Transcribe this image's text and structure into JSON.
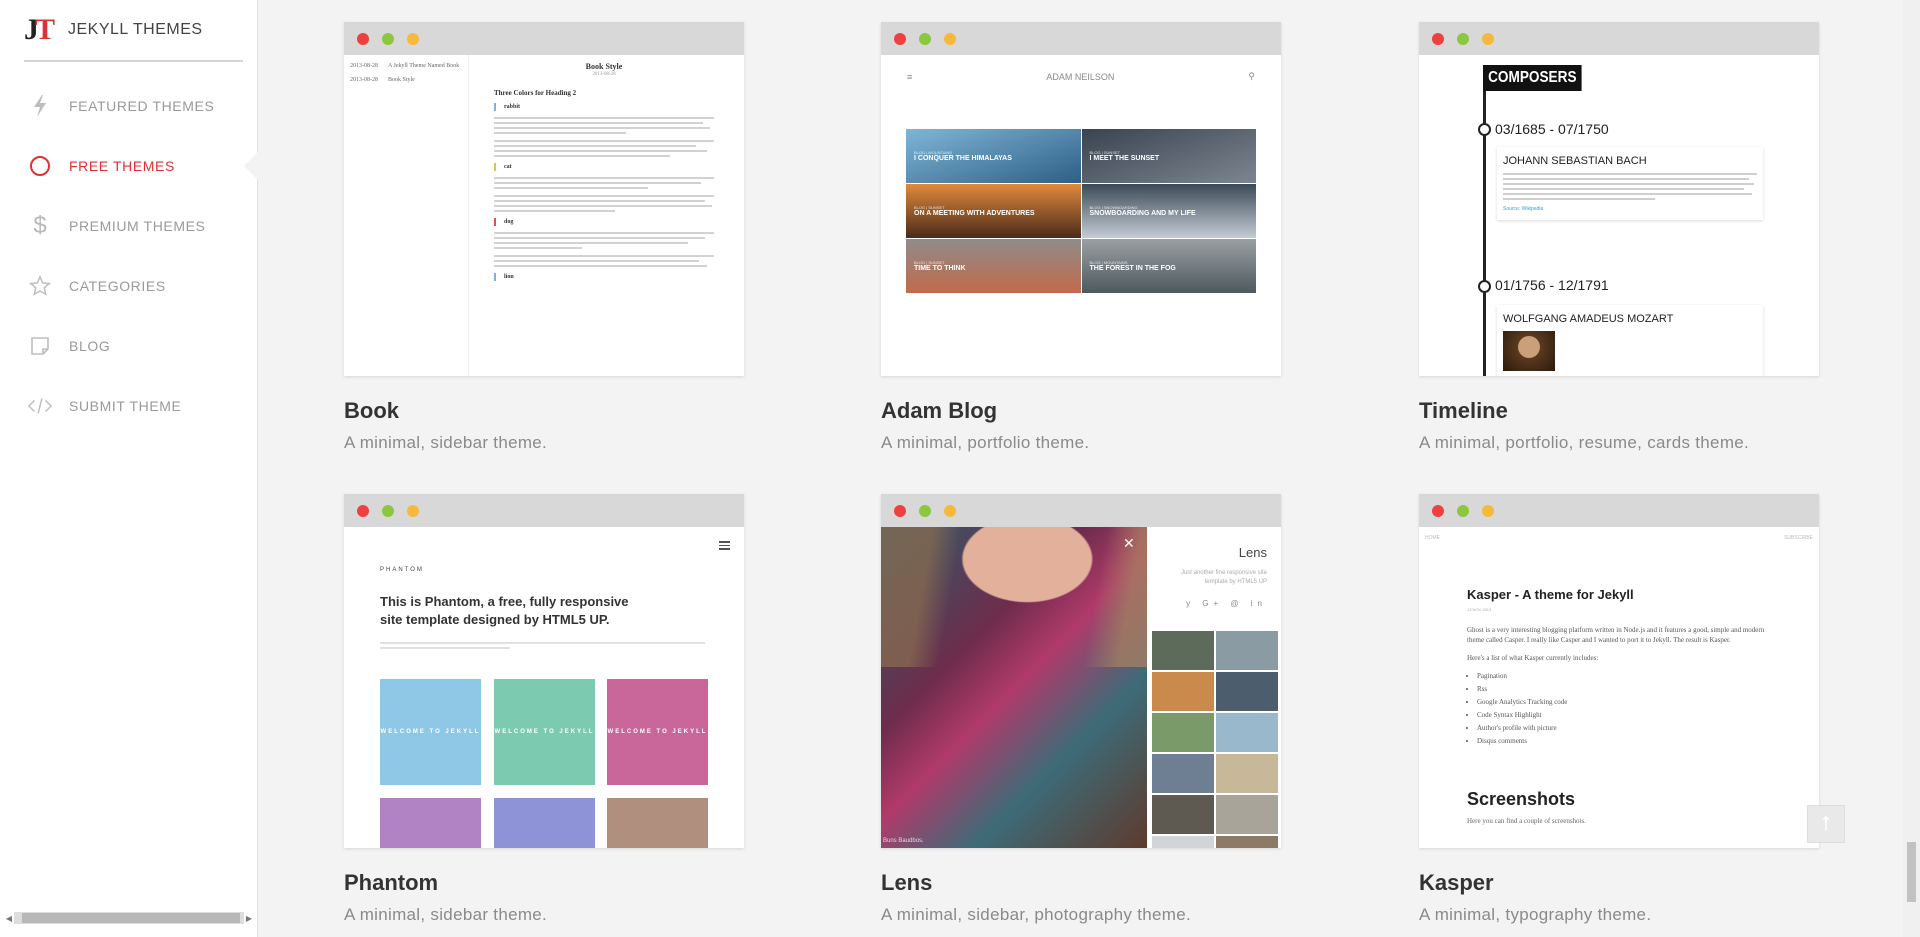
{
  "brand": {
    "name": "JEKYLL THEMES",
    "logo_text": "JT"
  },
  "nav": [
    {
      "label": "FEATURED THEMES",
      "icon": "bolt-icon"
    },
    {
      "label": "FREE THEMES",
      "icon": "circle-icon",
      "active": true
    },
    {
      "label": "PREMIUM THEMES",
      "icon": "dollar-icon"
    },
    {
      "label": "CATEGORIES",
      "icon": "star-icon"
    },
    {
      "label": "BLOG",
      "icon": "note-icon"
    },
    {
      "label": "SUBMIT THEME",
      "icon": "code-icon"
    }
  ],
  "themes": [
    {
      "name": "Book",
      "desc": "A minimal, sidebar theme."
    },
    {
      "name": "Adam Blog",
      "desc": "A minimal, portfolio theme."
    },
    {
      "name": "Timeline",
      "desc": "A minimal, portfolio, resume, cards theme."
    },
    {
      "name": "Phantom",
      "desc": "A minimal, sidebar theme."
    },
    {
      "name": "Lens",
      "desc": "A minimal, sidebar, photography theme."
    },
    {
      "name": "Kasper",
      "desc": "A minimal, typography theme."
    }
  ],
  "previews": {
    "book": {
      "side": [
        [
          "2013-08-28",
          "A Jekyll Theme Named Book"
        ],
        [
          "2013-08-28",
          "Book Style"
        ]
      ],
      "title": "Book Style",
      "date": "2013-08-28",
      "heading": "Three Colors for Heading 2",
      "tags": [
        "rabbit",
        "cat",
        "dog",
        "lion"
      ]
    },
    "adam": {
      "header": "ADAM NEILSON",
      "tiles": [
        {
          "cat": "BLOG | MOUNTAINS",
          "title": "I CONQUER THE HIMALAYAS"
        },
        {
          "cat": "BLOG | SUNSET",
          "title": "I MEET THE SUNSET"
        },
        {
          "cat": "BLOG | SUNSET",
          "title": "ON A MEETING WITH ADVENTURES"
        },
        {
          "cat": "BLOG | SNOWBOARDING",
          "title": "SNOWBOARDING AND MY LIFE"
        },
        {
          "cat": "BLOG | SUNSET",
          "title": "TIME TO THINK"
        },
        {
          "cat": "BLOG | MOUNTAINS",
          "title": "THE FOREST IN THE FOG"
        }
      ]
    },
    "timeline": {
      "title": "COMPOSERS",
      "entries": [
        {
          "date": "03/1685 - 07/1750",
          "name": "JOHANN SEBASTIAN BACH",
          "source": "Source: Wikipedia"
        },
        {
          "date": "01/1756 - 12/1791",
          "name": "WOLFGANG AMADEUS MOZART"
        }
      ]
    },
    "phantom": {
      "logo": "PHANTOM",
      "title": "This is Phantom, a free, fully responsive site template designed by HTML5 UP.",
      "tile_label": "WELCOME TO JEKYLL",
      "tile_colors": [
        "#8fc8e6",
        "#7ccbb0",
        "#c9679b",
        "#b283c4",
        "#8d93d6",
        "#b08f7e"
      ]
    },
    "lens": {
      "name": "Lens",
      "sub": "Just another fine responsive site template by HTML5 UP",
      "caption": "Buns Baudbos.",
      "social": "y G+ @ in",
      "thumb_colors": [
        "#5c6b5a",
        "#8a9ba3",
        "#c98a4c",
        "#4c5e6e",
        "#7a9a6a",
        "#9ab8cc",
        "#6e7f94",
        "#c8b89a",
        "#5e5a52",
        "#a8a49a",
        "#d0d6d8",
        "#8c7a66"
      ]
    },
    "kasper": {
      "nav_left": "HOME",
      "nav_right": "SUBSCRIBE",
      "title": "Kasper - A theme for Jekyll",
      "date": "13 NOV 2013",
      "intro": "Ghost is a very interesting blogging platform written in Node.js and it features a good, simple and modern theme called Casper. I really like Casper and I wanted to port it to Jekyll. The result is Kasper.",
      "list_intro": "Here's a list of what Kasper currently includes:",
      "list": [
        "Pagination",
        "Rss",
        "Google Analytics Tracking code",
        "Code Syntax Highlight",
        "Author's profile with picture",
        "Disqus comments"
      ],
      "heading": "Screenshots",
      "sub": "Here you can find a couple of screenshots."
    }
  },
  "colors": {
    "accent": "#e03030",
    "background": "#f3f3f3"
  }
}
